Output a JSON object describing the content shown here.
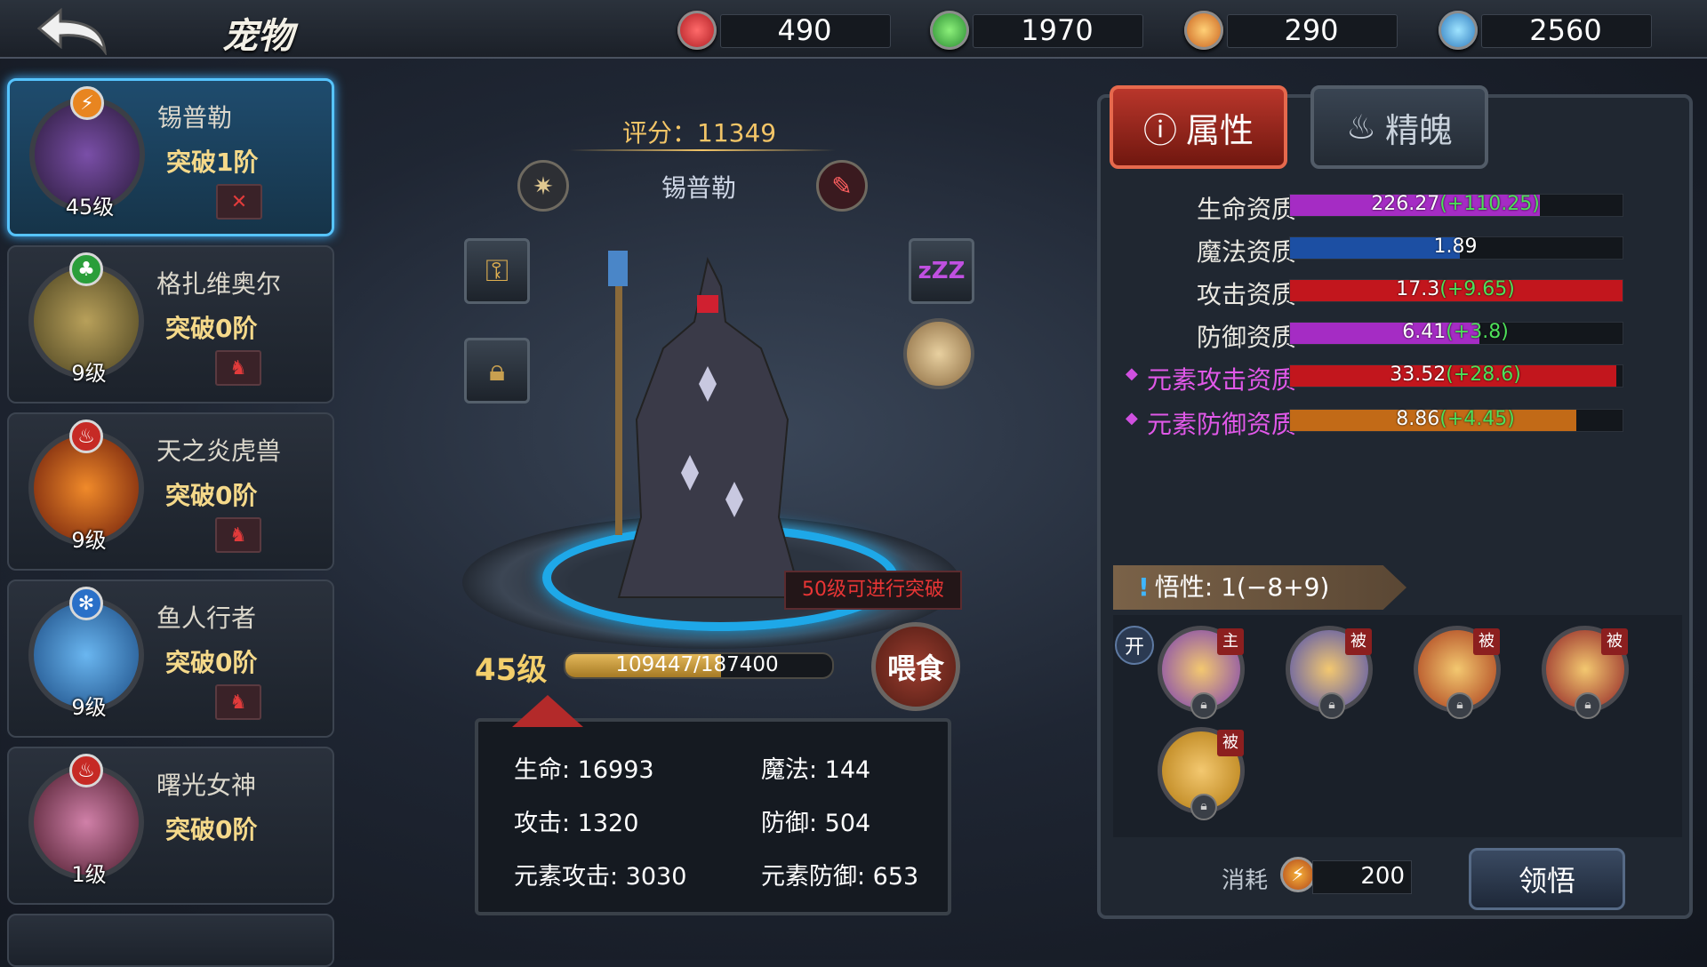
{
  "header": {
    "title": "宠物",
    "currencies": [
      {
        "icon": "red-fire-gem-icon",
        "value": "490",
        "color": "#d3262d"
      },
      {
        "icon": "green-leaf-gem-icon",
        "value": "1970",
        "color": "#2fae3b"
      },
      {
        "icon": "orange-lightning-gem-icon",
        "value": "290",
        "color": "#f08d1c"
      },
      {
        "icon": "blue-ice-gem-icon",
        "value": "2560",
        "color": "#2a8fd8"
      }
    ]
  },
  "pets": [
    {
      "name": "锡普勒",
      "stage": "突破1阶",
      "level": "45级",
      "element": "lightning",
      "selected": true
    },
    {
      "name": "格扎维奥尔",
      "stage": "突破0阶",
      "level": "9级",
      "element": "nature",
      "selected": false
    },
    {
      "name": "天之炎虎兽",
      "stage": "突破0阶",
      "level": "9级",
      "element": "fire",
      "selected": false
    },
    {
      "name": "鱼人行者",
      "stage": "突破0阶",
      "level": "9级",
      "element": "ice",
      "selected": false
    },
    {
      "name": "曙光女神",
      "stage": "突破0阶",
      "level": "1级",
      "element": "fire",
      "selected": false
    }
  ],
  "center": {
    "score": "评分：11349",
    "pet_name": "锡普勒",
    "breakthrough_tip": "50级可进行突破",
    "level": "45级",
    "exp": "109447/187400",
    "exp_fraction": 0.584,
    "feed_label": "喂食",
    "stats": {
      "hp": "生命: 16993",
      "mp": "魔法: 144",
      "atk": "攻击: 1320",
      "def": "防御: 504",
      "elem_atk": "元素攻击: 3030",
      "elem_def": "元素防御: 653"
    }
  },
  "right": {
    "tabs": {
      "attributes": "属性",
      "spirit": "精魄"
    },
    "attributes": [
      {
        "label": "生命资质",
        "value": "226.27",
        "bonus": "(+110.25)",
        "fill": 0.75,
        "color": "#a52cc4",
        "elemental": false
      },
      {
        "label": "魔法资质",
        "value": "1.89",
        "bonus": "",
        "fill": 0.51,
        "color": "#1c4fa3",
        "elemental": false
      },
      {
        "label": "攻击资质",
        "value": "17.3",
        "bonus": "(+9.65)",
        "fill": 1.0,
        "color": "#c2161d",
        "elemental": false
      },
      {
        "label": "防御资质",
        "value": "6.41",
        "bonus": "(+3.8)",
        "fill": 0.57,
        "color": "#a52cc4",
        "elemental": false
      },
      {
        "label": "元素攻击资质",
        "value": "33.52",
        "bonus": "(+28.6)",
        "fill": 0.98,
        "color": "#c2161d",
        "elemental": true
      },
      {
        "label": "元素防御资质",
        "value": "8.86",
        "bonus": "(+4.45)",
        "fill": 0.86,
        "color": "#c26a17",
        "elemental": true
      }
    ],
    "savvy": "悟性: 1(−8+9)",
    "open_label": "开",
    "skills": [
      {
        "tag": "主",
        "icon": "lightning-skill-icon",
        "color": "#7a3fb3"
      },
      {
        "tag": "被",
        "icon": "blade-skill-icon",
        "color": "#4a4cb0"
      },
      {
        "tag": "被",
        "icon": "lightning-sword-skill-icon",
        "color": "#a83a1a"
      },
      {
        "tag": "被",
        "icon": "potion-skill-icon",
        "color": "#8e1f24"
      },
      {
        "tag": "被",
        "icon": "lightning-shield-skill-icon",
        "color": "#b37a10"
      }
    ],
    "cost_label": "消耗",
    "cost_value": "200",
    "comprehend_label": "领悟"
  }
}
